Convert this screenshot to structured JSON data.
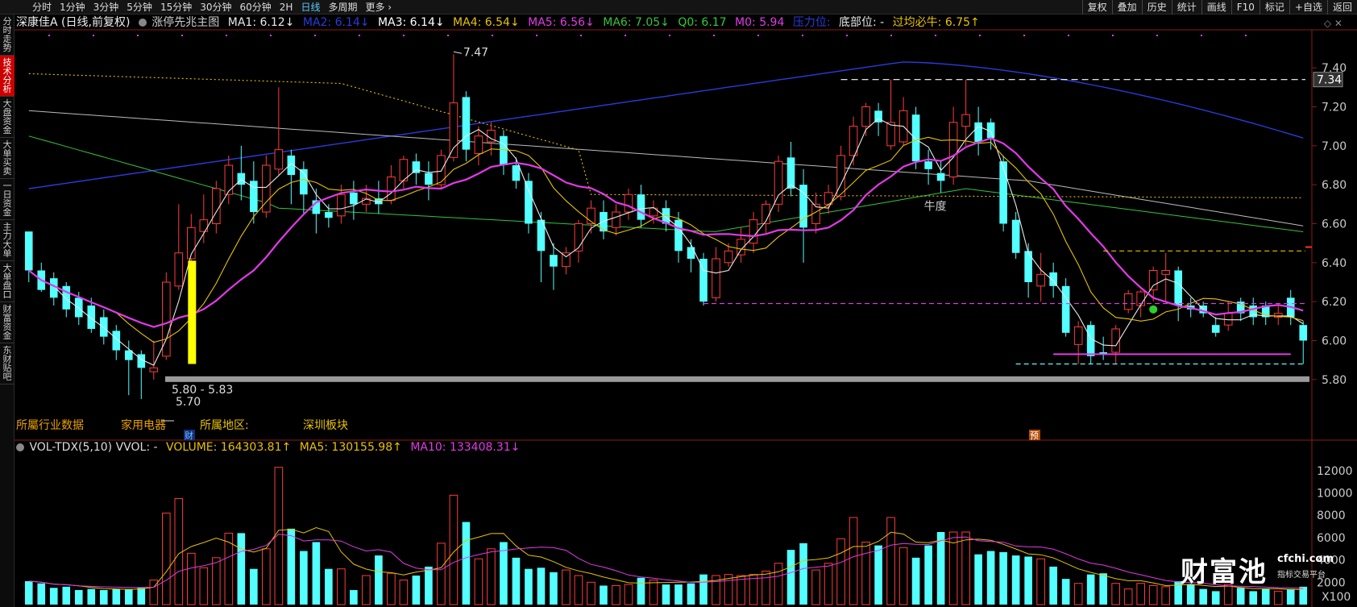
{
  "timeframes": [
    {
      "label": "分时",
      "active": false
    },
    {
      "label": "1分钟",
      "active": false
    },
    {
      "label": "3分钟",
      "active": false
    },
    {
      "label": "5分钟",
      "active": false
    },
    {
      "label": "15分钟",
      "active": false
    },
    {
      "label": "30分钟",
      "active": false
    },
    {
      "label": "60分钟",
      "active": false
    },
    {
      "label": "2H",
      "active": false
    },
    {
      "label": "日线",
      "active": true
    },
    {
      "label": "多周期",
      "active": false
    },
    {
      "label": "更多 ›",
      "active": false
    }
  ],
  "toolbar_right": [
    "复权",
    "叠加",
    "历史",
    "统计",
    "画线",
    "F10",
    "标记",
    "+自选",
    "返回"
  ],
  "side_tabs": [
    {
      "label": "分时走势",
      "active": false
    },
    {
      "label": "技术分析",
      "active": true
    },
    {
      "label": "大盘资金",
      "active": false
    },
    {
      "label": "大单买卖",
      "active": false
    },
    {
      "label": "一日资金",
      "active": false
    },
    {
      "label": "主力大单",
      "active": false
    },
    {
      "label": "大单盘口",
      "active": false
    },
    {
      "label": "财富资金",
      "active": false
    },
    {
      "label": "东财贴吧",
      "active": false
    }
  ],
  "header": {
    "stock": "深康佳A (日线,前复权)",
    "indicator": "涨停先兆主图",
    "ma1": "MA1: 6.12↓",
    "ma2": "MA2: 6.14↓",
    "ma3": "MA3: 6.14↓",
    "ma4": "MA4: 6.54↓",
    "ma5": "MA5: 6.56↓",
    "ma6": "MA6: 7.05↓",
    "q0": "Q0: 6.17",
    "m0": "M0: 5.94",
    "pressure": "压力位: ",
    "bottom_pos": "底部位: -",
    "gk": "过均必牛: 6.75↑"
  },
  "vol_header": {
    "name": "VOL-TDX(5,10) VVOL: -",
    "volume": "VOLUME: 164303.81↑",
    "ma5": "MA5: 130155.98↑",
    "ma10": "MA10: 133408.31↓"
  },
  "annotations": {
    "high": "7.47",
    "range": "5.80 - 5.83",
    "low": "5.70",
    "cow": "牛度",
    "marker_cai": "财",
    "marker_yu": "预",
    "price_tag": "7.34"
  },
  "bottom_labels": {
    "industry": "所屬行业数据",
    "industry_link": "家用电器",
    "region": "所属地区:",
    "region_link": "深圳板块"
  },
  "price_axis": [
    "7.40",
    "7.20",
    "7.00",
    "6.80",
    "6.60",
    "6.40",
    "6.20",
    "6.00",
    "5.80"
  ],
  "vol_axis": [
    "12000",
    "10000",
    "8000",
    "6000",
    "4000",
    "2000",
    "X100"
  ],
  "logo": {
    "main": "财富池",
    "site": "cfchi.com",
    "sub": "指标交易平台"
  },
  "colors": {
    "up": "#ff3b3b",
    "down": "#54ffff",
    "ma_white": "#e8e8e8",
    "ma_yellow": "#e8c200",
    "ma_magenta": "#e23ae8",
    "ma_blue": "#2a3bdc",
    "ma_green": "#35c43a"
  },
  "chart_data": {
    "type": "candlestick",
    "price_ylim": [
      5.7,
      7.5
    ],
    "candles": [
      [
        6.56,
        6.52,
        6.36,
        6.3,
        0
      ],
      [
        6.36,
        6.4,
        6.26,
        6.25,
        0
      ],
      [
        6.32,
        6.35,
        6.22,
        6.18,
        0
      ],
      [
        6.28,
        6.3,
        6.16,
        6.12,
        0
      ],
      [
        6.22,
        6.25,
        6.12,
        6.08,
        0
      ],
      [
        6.18,
        6.22,
        6.06,
        6.04,
        0
      ],
      [
        6.12,
        6.16,
        6.02,
        5.98,
        0
      ],
      [
        6.05,
        6.08,
        5.95,
        5.9,
        0
      ],
      [
        5.95,
        6.0,
        5.9,
        5.72,
        0
      ],
      [
        5.93,
        5.95,
        5.86,
        5.7,
        0
      ],
      [
        5.84,
        6.0,
        5.86,
        5.8,
        1
      ],
      [
        5.92,
        6.35,
        6.3,
        5.9,
        1
      ],
      [
        6.28,
        6.7,
        6.45,
        6.26,
        1
      ],
      [
        6.42,
        6.65,
        6.58,
        6.4,
        1
      ],
      [
        6.56,
        6.75,
        6.62,
        6.5,
        1
      ],
      [
        6.6,
        6.82,
        6.78,
        6.55,
        1
      ],
      [
        6.75,
        6.95,
        6.9,
        6.7,
        1
      ],
      [
        6.86,
        7.0,
        6.8,
        6.72,
        0
      ],
      [
        6.82,
        6.92,
        6.66,
        6.6,
        0
      ],
      [
        6.66,
        6.95,
        6.9,
        6.63,
        1
      ],
      [
        6.88,
        7.3,
        6.98,
        6.85,
        1
      ],
      [
        6.95,
        6.98,
        6.85,
        6.7,
        0
      ],
      [
        6.88,
        6.92,
        6.75,
        6.65,
        0
      ],
      [
        6.72,
        6.78,
        6.65,
        6.55,
        0
      ],
      [
        6.66,
        6.7,
        6.63,
        6.58,
        0
      ],
      [
        6.64,
        6.8,
        6.75,
        6.6,
        1
      ],
      [
        6.76,
        6.82,
        6.7,
        6.62,
        0
      ],
      [
        6.7,
        6.8,
        6.73,
        6.66,
        1
      ],
      [
        6.73,
        6.82,
        6.7,
        6.65,
        0
      ],
      [
        6.72,
        6.9,
        6.84,
        6.7,
        1
      ],
      [
        6.82,
        6.95,
        6.93,
        6.78,
        1
      ],
      [
        6.92,
        6.96,
        6.86,
        6.8,
        0
      ],
      [
        6.86,
        6.92,
        6.8,
        6.72,
        0
      ],
      [
        6.8,
        6.98,
        6.95,
        6.78,
        1
      ],
      [
        6.94,
        7.47,
        7.22,
        6.92,
        1
      ],
      [
        7.25,
        7.28,
        6.98,
        6.92,
        0
      ],
      [
        6.96,
        7.1,
        7.05,
        6.9,
        1
      ],
      [
        7.02,
        7.12,
        7.08,
        6.95,
        1
      ],
      [
        7.05,
        7.08,
        6.9,
        6.85,
        0
      ],
      [
        6.9,
        6.94,
        6.82,
        6.78,
        0
      ],
      [
        6.82,
        6.86,
        6.6,
        6.55,
        0
      ],
      [
        6.62,
        6.66,
        6.46,
        6.3,
        0
      ],
      [
        6.44,
        6.5,
        6.38,
        6.26,
        0
      ],
      [
        6.38,
        6.48,
        6.45,
        6.34,
        1
      ],
      [
        6.46,
        6.62,
        6.6,
        6.4,
        1
      ],
      [
        6.6,
        6.72,
        6.68,
        6.55,
        1
      ],
      [
        6.66,
        6.72,
        6.56,
        6.52,
        0
      ],
      [
        6.58,
        6.7,
        6.66,
        6.54,
        1
      ],
      [
        6.66,
        6.78,
        6.75,
        6.62,
        1
      ],
      [
        6.75,
        6.8,
        6.62,
        6.58,
        0
      ],
      [
        6.64,
        6.72,
        6.68,
        6.6,
        1
      ],
      [
        6.68,
        6.72,
        6.6,
        6.56,
        0
      ],
      [
        6.62,
        6.66,
        6.46,
        6.4,
        0
      ],
      [
        6.48,
        6.52,
        6.42,
        6.35,
        0
      ],
      [
        6.42,
        6.45,
        6.2,
        6.18,
        0
      ],
      [
        6.22,
        6.48,
        6.42,
        6.2,
        1
      ],
      [
        6.4,
        6.5,
        6.46,
        6.38,
        1
      ],
      [
        6.44,
        6.58,
        6.52,
        6.4,
        1
      ],
      [
        6.5,
        6.66,
        6.62,
        6.45,
        1
      ],
      [
        6.6,
        6.72,
        6.7,
        6.55,
        1
      ],
      [
        6.7,
        6.95,
        6.92,
        6.66,
        1
      ],
      [
        6.94,
        7.02,
        6.78,
        6.74,
        0
      ],
      [
        6.8,
        6.88,
        6.58,
        6.4,
        0
      ],
      [
        6.6,
        6.76,
        6.7,
        6.55,
        1
      ],
      [
        6.7,
        6.8,
        6.76,
        6.65,
        1
      ],
      [
        6.74,
        7.0,
        6.95,
        6.72,
        1
      ],
      [
        6.95,
        7.15,
        7.1,
        6.9,
        1
      ],
      [
        7.1,
        7.22,
        7.2,
        7.05,
        1
      ],
      [
        7.18,
        7.22,
        7.12,
        7.05,
        0
      ],
      [
        7.12,
        7.34,
        7.0,
        6.98,
        1
      ],
      [
        7.02,
        7.25,
        7.18,
        7.0,
        1
      ],
      [
        7.16,
        7.2,
        6.92,
        6.88,
        0
      ],
      [
        6.92,
        6.98,
        6.88,
        6.8,
        0
      ],
      [
        6.86,
        6.92,
        6.82,
        6.76,
        0
      ],
      [
        6.84,
        7.2,
        7.12,
        6.8,
        1
      ],
      [
        7.1,
        7.34,
        7.16,
        7.0,
        1
      ],
      [
        7.12,
        7.2,
        7.02,
        6.95,
        0
      ],
      [
        7.12,
        7.14,
        7.04,
        6.98,
        0
      ],
      [
        6.92,
        6.95,
        6.6,
        6.56,
        0
      ],
      [
        6.62,
        6.66,
        6.45,
        6.42,
        0
      ],
      [
        6.46,
        6.5,
        6.3,
        6.22,
        0
      ],
      [
        6.28,
        6.45,
        6.34,
        6.2,
        1
      ],
      [
        6.35,
        6.4,
        6.28,
        6.22,
        0
      ],
      [
        6.28,
        6.32,
        6.04,
        6.02,
        0
      ],
      [
        5.98,
        6.1,
        6.07,
        5.88,
        1
      ],
      [
        6.08,
        6.1,
        5.92,
        5.88,
        0
      ],
      [
        5.93,
        6.02,
        5.94,
        5.9,
        0
      ],
      [
        5.94,
        6.08,
        6.06,
        5.88,
        1
      ],
      [
        6.16,
        6.26,
        6.24,
        6.14,
        1
      ],
      [
        6.18,
        6.26,
        6.25,
        6.12,
        1
      ],
      [
        6.26,
        6.38,
        6.36,
        6.2,
        1
      ],
      [
        6.36,
        6.45,
        6.34,
        6.2,
        1
      ],
      [
        6.36,
        6.38,
        6.18,
        6.1,
        0
      ],
      [
        6.18,
        6.22,
        6.16,
        6.12,
        0
      ],
      [
        6.18,
        6.2,
        6.14,
        6.12,
        0
      ],
      [
        6.08,
        6.12,
        6.04,
        6.02,
        0
      ],
      [
        6.08,
        6.2,
        6.14,
        6.05,
        1
      ],
      [
        6.2,
        6.22,
        6.14,
        6.1,
        0
      ],
      [
        6.18,
        6.22,
        6.12,
        6.08,
        0
      ],
      [
        6.18,
        6.2,
        6.12,
        6.08,
        0
      ],
      [
        6.12,
        6.18,
        6.14,
        6.08,
        1
      ],
      [
        6.22,
        6.26,
        6.12,
        6.08,
        0
      ],
      [
        6.08,
        6.1,
        6.0,
        5.88,
        0
      ]
    ],
    "volume": [
      2100,
      1900,
      1500,
      1600,
      1300,
      1400,
      1300,
      1400,
      1400,
      1500,
      2200,
      8200,
      9500,
      4600,
      3300,
      4200,
      6400,
      6400,
      3200,
      5000,
      12300,
      6800,
      4800,
      5600,
      3200,
      3200,
      1300,
      2600,
      4400,
      2800,
      2200,
      2600,
      3400,
      5500,
      9800,
      7400,
      4100,
      5000,
      5600,
      4200,
      3200,
      3300,
      2900,
      3100,
      2600,
      2000,
      1700,
      1700,
      1800,
      2400,
      2200,
      1800,
      1800,
      1900,
      2700,
      2600,
      2700,
      2600,
      2700,
      3000,
      3700,
      4900,
      5500,
      3100,
      3700,
      5900,
      7800,
      5600,
      5300,
      7800,
      5100,
      4200,
      5300,
      6500,
      6500,
      6500,
      4500,
      4800,
      4700,
      4400,
      4300,
      4100,
      3400,
      2300,
      1900,
      2700,
      2800,
      1900,
      1400,
      1900,
      1700,
      1600,
      2100,
      1800,
      1400,
      1200,
      1800,
      1500,
      1200,
      1400,
      1200,
      1400,
      1600
    ],
    "vol_ylim": [
      0,
      13000
    ],
    "price_labels": [
      "7.40",
      "7.20",
      "7.00",
      "6.80",
      "6.60",
      "6.40",
      "6.20",
      "6.00",
      "5.80"
    ],
    "volume_labels": [
      "12000",
      "10000",
      "8000",
      "6000",
      "4000",
      "2000"
    ]
  }
}
